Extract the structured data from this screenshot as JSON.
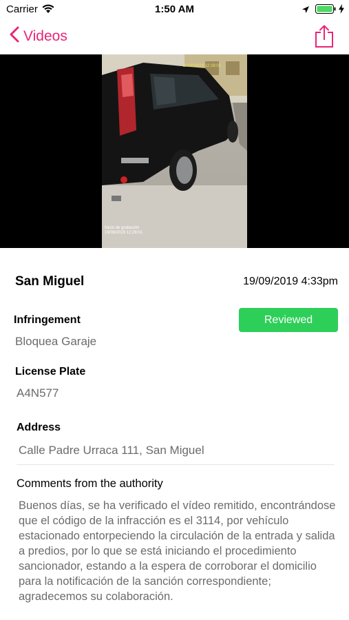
{
  "status_bar": {
    "carrier": "Carrier",
    "time": "1:50 AM",
    "battery_color": "#4cd964"
  },
  "nav": {
    "back_label": "Videos",
    "back_icon": "chevron-left-icon",
    "share_icon": "share-icon",
    "accent_color": "#e8247a"
  },
  "video": {
    "overlay_top": "2019/09/19 12:28:01",
    "overlay_bottom_line1": "Inicio de grabación",
    "overlay_bottom_line2": "19/09/2019 12:28:01"
  },
  "report": {
    "location": "San Miguel",
    "date": "19/09/2019 4:33pm",
    "infringement_label": "Infringement",
    "infringement_value": "Bloquea Garaje",
    "status_label": "Reviewed",
    "status_color": "#2dcf59",
    "plate_label": "License Plate",
    "plate_value": "A4N577",
    "address_label": "Address",
    "address_value": "Calle Padre Urraca 111, San Miguel",
    "comments_label": "Comments from the authority",
    "comments_value": "Buenos días, se ha verificado el vídeo remitido, encontrándose que el código de la infracción es el 3114, por vehículo estacionado entorpeciendo la circulación de la entrada y salida a predios, por lo que se está iniciando el procedimiento sancionador, estando a la espera de corroborar el domicilio para la notificación de la sanción correspondiente; agradecemos su colaboración."
  }
}
